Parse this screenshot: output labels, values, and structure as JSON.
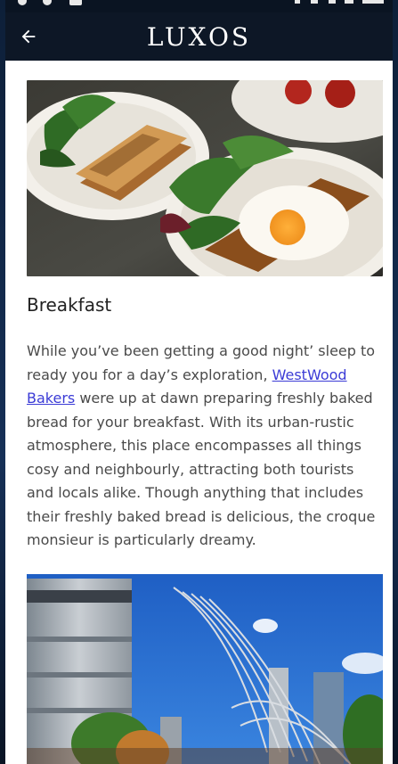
{
  "app": {
    "brand": "LUXOS",
    "back_icon": "arrow-left-icon"
  },
  "article": {
    "title": "Breakfast",
    "paragraph_before_link": "While you’ve been getting a good night’ sleep to ready you for a day’s exploration, ",
    "link_text": "WestWood Bakers",
    "paragraph_after_link": " were up at dawn preparing  freshly baked bread for your breakfast. With its urban-rustic atmosphere, this place encompasses all things cosy and neighbourly, attracting both tourists and locals alike. Though anything that includes their freshly baked bread is delicious, the croque monsieur is particularly dreamy."
  },
  "colors": {
    "app_bar": "#0d1726",
    "link": "#3b3bd6",
    "text": "#4a4a4a",
    "title": "#222222"
  }
}
